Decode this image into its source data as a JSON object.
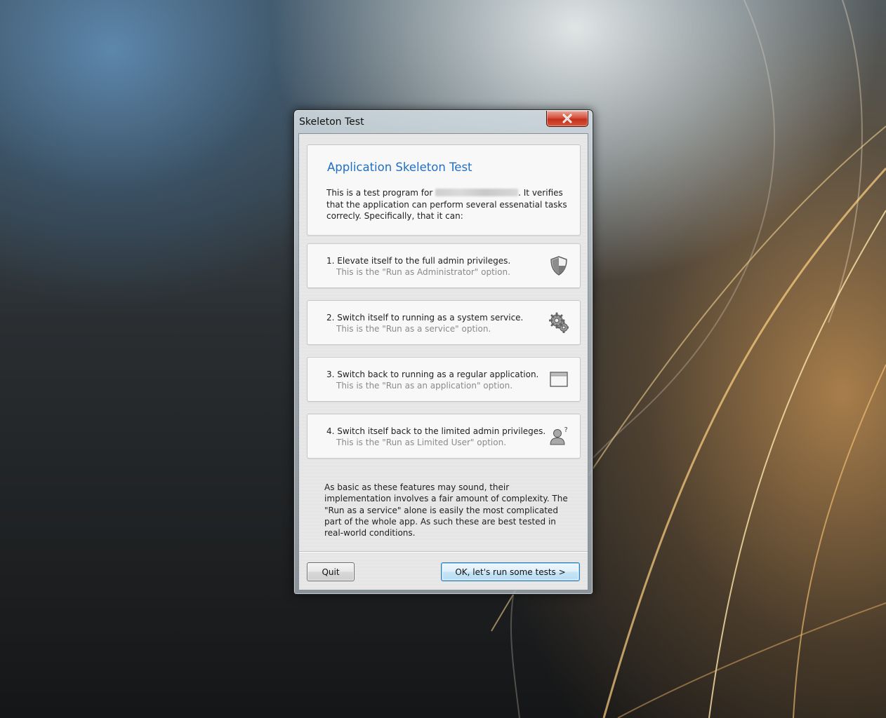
{
  "window": {
    "title": "Skeleton Test"
  },
  "intro": {
    "heading": "Application Skeleton Test",
    "text_before": "This is a test program for ",
    "text_after": ". It verifies that the application can perform several essenatial tasks correcly. Specifically, that it can:"
  },
  "features": [
    {
      "title": "1. Elevate itself to the full admin privileges.",
      "subtitle": "This is the \"Run as Administrator\" option.",
      "icon": "shield-icon"
    },
    {
      "title": "2. Switch itself to running as a system service.",
      "subtitle": "This is the \"Run as a service\" option.",
      "icon": "gears-icon"
    },
    {
      "title": "3. Switch back to running as a regular application.",
      "subtitle": "This is the \"Run as an application\" option.",
      "icon": "window-icon"
    },
    {
      "title": "4. Switch itself back to the limited admin privileges.",
      "subtitle": "This is the \"Run as Limited User\" option.",
      "icon": "user-question-icon"
    }
  ],
  "outro": "As basic as these features may sound, their implementation involves a fair amount of complexity. The \"Run as a service\" alone is easily the most complicated part of the whole app. As such these are best tested in real-world conditions.",
  "buttons": {
    "quit": "Quit",
    "ok": "OK, let's run some tests >"
  }
}
